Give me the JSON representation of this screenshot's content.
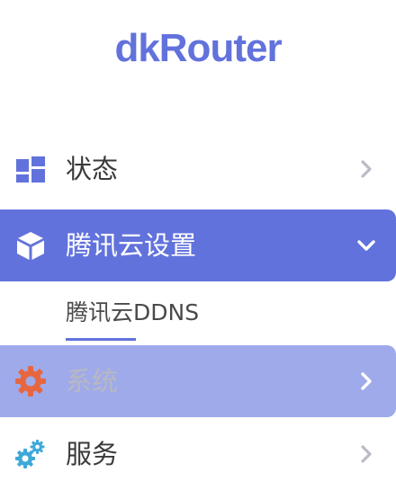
{
  "brand": {
    "logo_text": "dkRouter"
  },
  "colors": {
    "accent": "#6272dc",
    "active_bg": "#6272dc",
    "hover_bg": "#9faaea",
    "system_icon": "#e8663f",
    "service_icon": "#3ea9d8"
  },
  "nav": {
    "items": [
      {
        "label": "状态",
        "icon": "dashboard-grid-icon",
        "state": "collapsed"
      },
      {
        "label": "腾讯云设置",
        "icon": "cube-icon",
        "state": "expanded"
      },
      {
        "label": "系统",
        "icon": "gear-icon",
        "state": "hover"
      },
      {
        "label": "服务",
        "icon": "gears-icon",
        "state": "collapsed"
      }
    ],
    "sub_items": [
      {
        "label": "腾讯云DDNS",
        "active": true
      }
    ]
  }
}
